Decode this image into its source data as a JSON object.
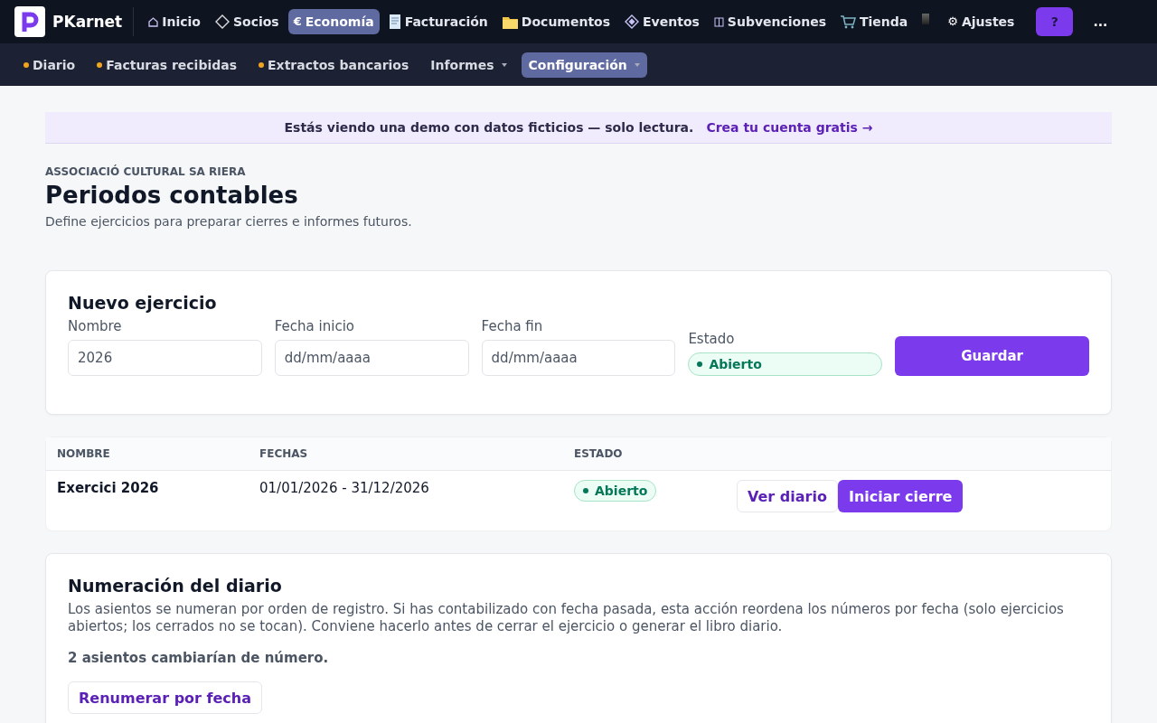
{
  "brand": {
    "name": "PKarnet"
  },
  "nav": [
    {
      "label": "Inicio",
      "selected": false
    },
    {
      "label": "Socios",
      "selected": false
    },
    {
      "label": "Economía",
      "selected": true,
      "glyph": "€"
    },
    {
      "label": "Facturación",
      "selected": false
    },
    {
      "label": "Documentos",
      "selected": false
    },
    {
      "label": "Eventos",
      "selected": false
    },
    {
      "label": "Subvenciones",
      "selected": false
    },
    {
      "label": "Tienda",
      "selected": false
    },
    {
      "label": "Ajustes",
      "selected": false,
      "glyph": "⚙"
    }
  ],
  "help_button": "?",
  "more_button": "...",
  "subnav": [
    {
      "label": "Diario",
      "dot": true,
      "dropdown": false,
      "selected": false
    },
    {
      "label": "Facturas recibidas",
      "dot": true,
      "dropdown": false,
      "selected": false
    },
    {
      "label": "Extractos bancarios",
      "dot": true,
      "dropdown": false,
      "selected": false
    },
    {
      "label": "Informes",
      "dot": false,
      "dropdown": true,
      "selected": false
    },
    {
      "label": "Configuración",
      "dot": false,
      "dropdown": true,
      "selected": true
    }
  ],
  "banner": {
    "text": "Estás viendo una demo con datos ficticios — solo lectura.",
    "link": "Crea tu cuenta gratis →"
  },
  "header": {
    "org": "ASSOCIACIÓ CULTURAL SA RIERA",
    "title": "Periodos contables",
    "subtitle": "Define ejercicios para preparar cierres e informes futuros."
  },
  "form": {
    "title": "Nuevo ejercicio",
    "fields": [
      {
        "label": "Nombre",
        "value": "2026"
      },
      {
        "label": "Fecha inicio",
        "placeholder": "dd/mm/aaaa"
      },
      {
        "label": "Fecha fin",
        "placeholder": "dd/mm/aaaa"
      }
    ],
    "status_label": "Estado",
    "status": "Abierto",
    "save": "Guardar"
  },
  "table": {
    "columns": [
      "NOMBRE",
      "FECHAS",
      "ESTADO"
    ],
    "rows": [
      {
        "name": "Exercici 2026",
        "dates": "01/01/2026 - 31/12/2026",
        "status": "Abierto",
        "actions": [
          "Ver diario",
          "Iniciar cierre"
        ]
      }
    ]
  },
  "renumber": {
    "title": "Numeración del diario",
    "text": "Los asientos se numeran por orden de registro. Si has contabilizado con fecha pasada, esta acción reordena los números por fecha (solo ejercicios abiertos; los cerrados no se tocan). Conviene hacerlo antes de cerrar el ejercicio o generar el libro diario.",
    "count": "2 asientos cambiarían de número.",
    "button": "Renumerar por fecha"
  }
}
